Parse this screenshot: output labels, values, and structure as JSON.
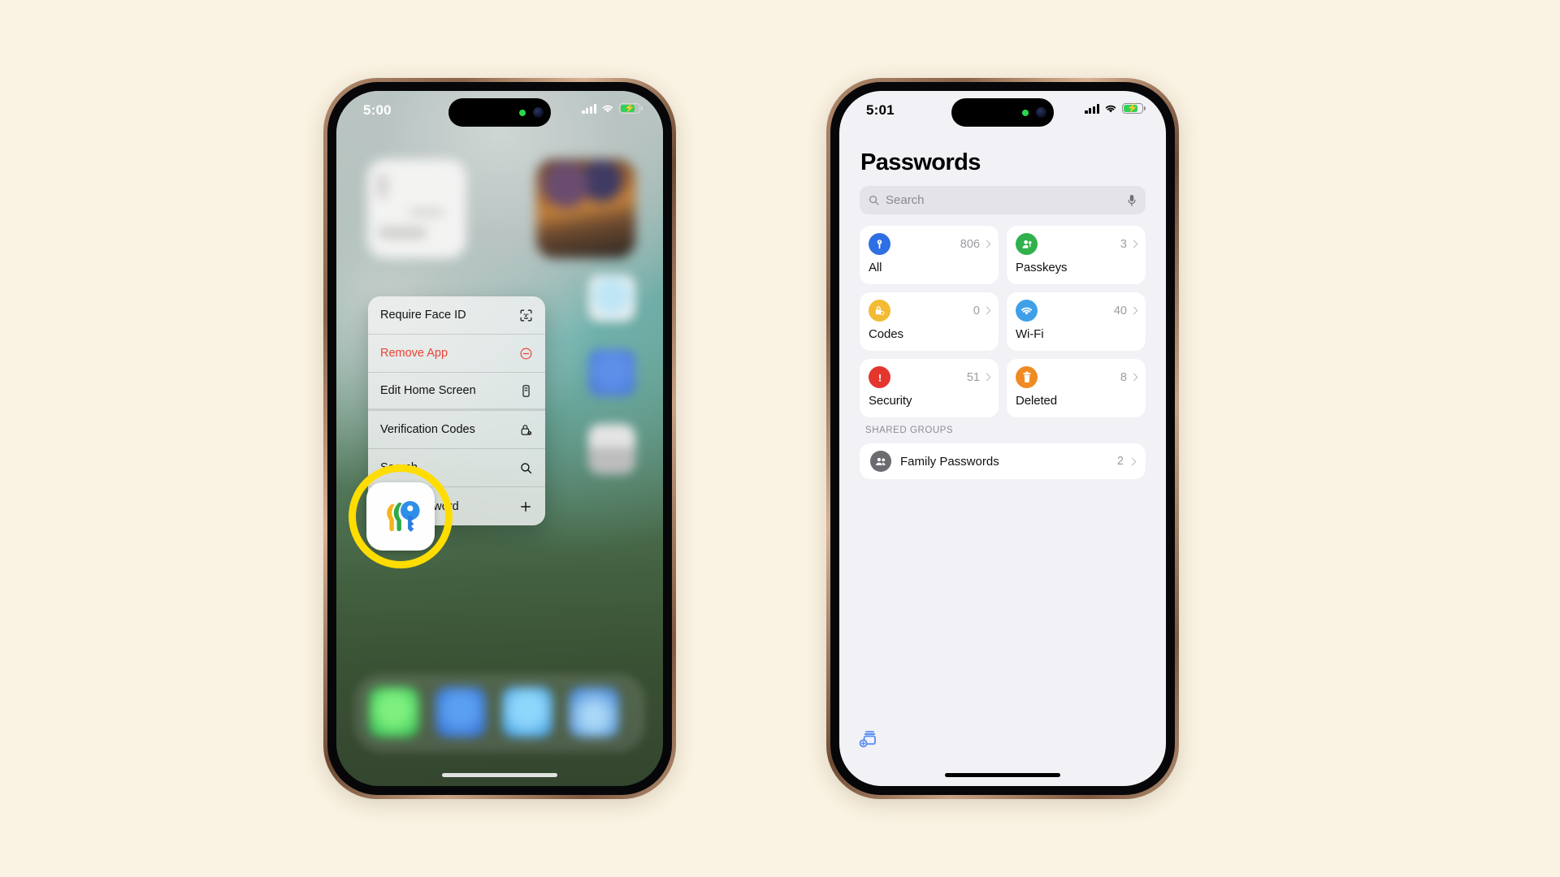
{
  "page": {
    "background_color": "#faf2e2"
  },
  "phone_left": {
    "name": "iPhone home screen with app context menu",
    "status": {
      "time": "5:00",
      "cellular_icon": "signal-bars-icon",
      "wifi_icon": "wifi-icon",
      "battery_icon": "battery-charging-icon"
    },
    "context_menu": {
      "items": [
        {
          "label": "Require Face ID",
          "icon": "face-id-icon",
          "style": "default"
        },
        {
          "label": "Remove App",
          "icon": "minus-circle-icon",
          "style": "destructive"
        },
        {
          "label": "Edit Home Screen",
          "icon": "edit-home-screen-icon",
          "style": "default"
        },
        {
          "label": "Verification Codes",
          "icon": "lock-clock-icon",
          "style": "default"
        },
        {
          "label": "Search",
          "icon": "search-icon",
          "style": "default"
        },
        {
          "label": "New Password",
          "icon": "plus-icon",
          "style": "default"
        }
      ]
    },
    "highlight": {
      "target": "Passwords app icon",
      "ring_color": "#ffdd00"
    },
    "app_icon": {
      "name": "Passwords",
      "icon": "passwords-keys-icon",
      "key_colors": [
        "#f5b417",
        "#2eab46",
        "#2f8fe8"
      ]
    }
  },
  "phone_right": {
    "name": "Passwords app main screen",
    "status": {
      "time": "5:01",
      "cellular_icon": "signal-bars-icon",
      "wifi_icon": "wifi-icon",
      "battery_icon": "battery-charging-icon"
    },
    "title": "Passwords",
    "search": {
      "placeholder": "Search",
      "value": "",
      "leading_icon": "search-icon",
      "trailing_icon": "microphone-icon"
    },
    "categories": [
      {
        "label": "All",
        "count": "806",
        "icon": "key-icon",
        "color": "#2f6fe4"
      },
      {
        "label": "Passkeys",
        "count": "3",
        "icon": "passkey-person-icon",
        "color": "#31b14b"
      },
      {
        "label": "Codes",
        "count": "0",
        "icon": "lock-clock-icon",
        "color": "#f3bb34"
      },
      {
        "label": "Wi-Fi",
        "count": "40",
        "icon": "wifi-icon",
        "color": "#3fa0e8"
      },
      {
        "label": "Security",
        "count": "51",
        "icon": "exclamation-icon",
        "color": "#e5362d"
      },
      {
        "label": "Deleted",
        "count": "8",
        "icon": "trash-icon",
        "color": "#ef8b22"
      }
    ],
    "shared_groups": {
      "header": "SHARED GROUPS",
      "rows": [
        {
          "label": "Family Passwords",
          "count": "2",
          "icon": "people-group-icon"
        }
      ]
    },
    "new_password_button": {
      "icon": "new-password-icon",
      "color": "#5a8ff0"
    }
  }
}
